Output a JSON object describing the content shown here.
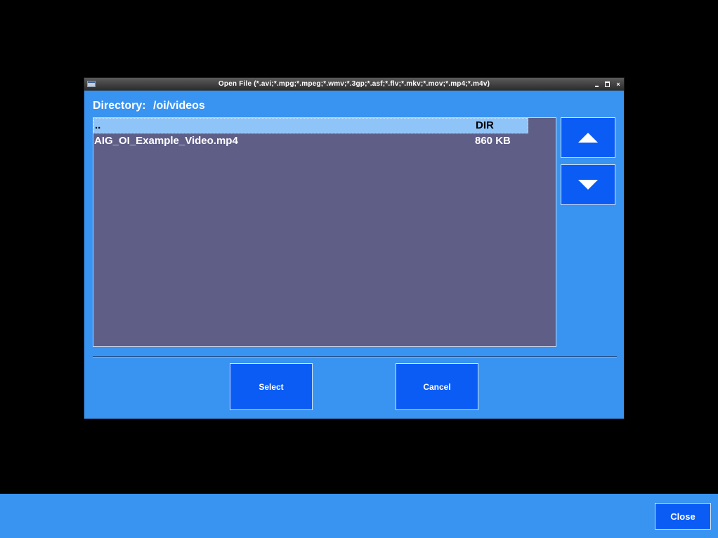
{
  "window": {
    "title": "Open File (*.avi;*.mpg;*.mpeg;*.wmv;*.3gp;*.asf;*.flv;*.mkv;*.mov;*.mp4;*.m4v)",
    "controls": {
      "minimize": "minimize-icon",
      "maximize": "maximize-icon",
      "close": "×"
    }
  },
  "directory": {
    "label": "Directory:",
    "path": "/oi/videos"
  },
  "files": [
    {
      "name": "..",
      "size": "DIR",
      "selected": true
    },
    {
      "name": "AIG_OI_Example_Video.mp4",
      "size": "860 KB",
      "selected": false
    }
  ],
  "scroll": {
    "up_icon": "arrow-up-icon",
    "down_icon": "arrow-down-icon"
  },
  "buttons": {
    "select": "Select",
    "cancel": "Cancel"
  },
  "bottombar": {
    "close": "Close"
  },
  "colors": {
    "background": "#000000",
    "dialog": "#3893f1",
    "button": "#0b5cf5",
    "list": "#5f5e87",
    "selected_row": "#8fc4f8"
  }
}
